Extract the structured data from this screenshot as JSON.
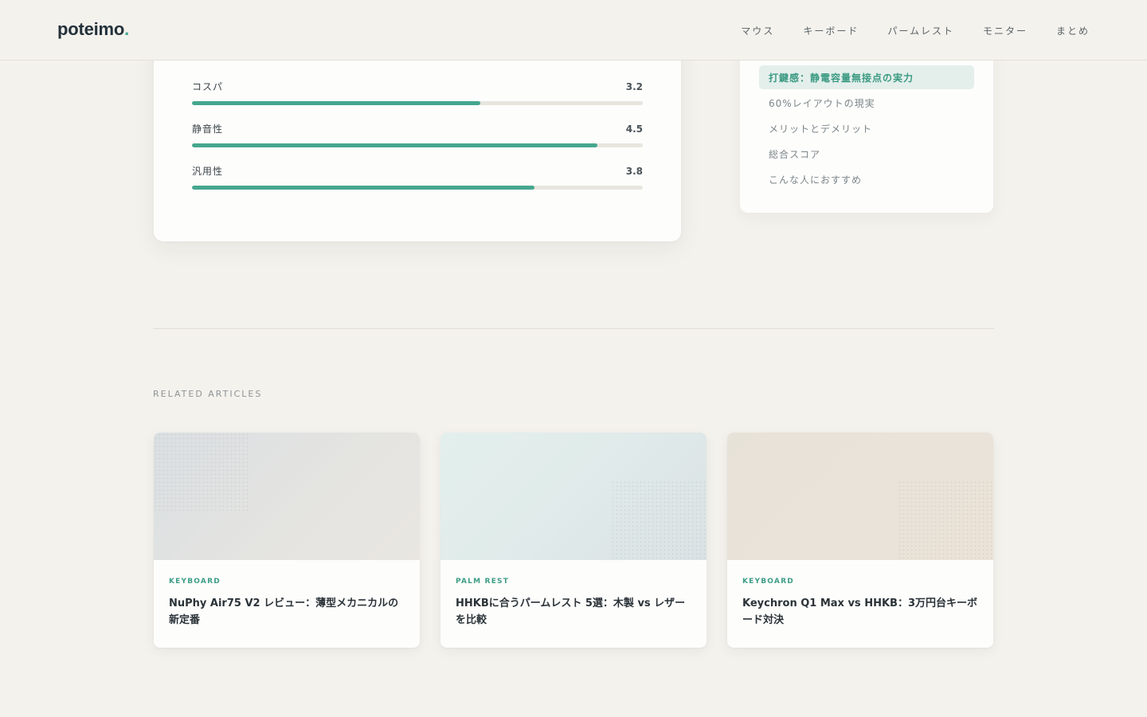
{
  "header": {
    "logo_text": "poteimo",
    "logo_dot": ".",
    "nav": [
      "マウス",
      "キーボード",
      "パームレスト",
      "モニター",
      "まとめ"
    ]
  },
  "scores": [
    {
      "label": "コスパ",
      "value": "3.2",
      "fraction": 0.64
    },
    {
      "label": "静音性",
      "value": "4.5",
      "fraction": 0.9
    },
    {
      "label": "汎用性",
      "value": "3.8",
      "fraction": 0.76
    }
  ],
  "top_bar_fraction": 0.9,
  "toc": {
    "items": [
      {
        "label": "打鍵感：静電容量無接点の実力",
        "active": true
      },
      {
        "label": "60%レイアウトの現実",
        "active": false
      },
      {
        "label": "メリットとデメリット",
        "active": false
      },
      {
        "label": "総合スコア",
        "active": false
      },
      {
        "label": "こんな人におすすめ",
        "active": false
      }
    ]
  },
  "related": {
    "title": "RELATED ARTICLES",
    "cards": [
      {
        "category": "KEYBOARD",
        "title": "NuPhy Air75 V2 レビュー：薄型メカニカルの新定番"
      },
      {
        "category": "PALM REST",
        "title": "HHKBに合うパームレスト 5選：木製 vs レザーを比較"
      },
      {
        "category": "KEYBOARD",
        "title": "Keychron Q1 Max vs HHKB：3万円台キーボード対決"
      }
    ]
  }
}
